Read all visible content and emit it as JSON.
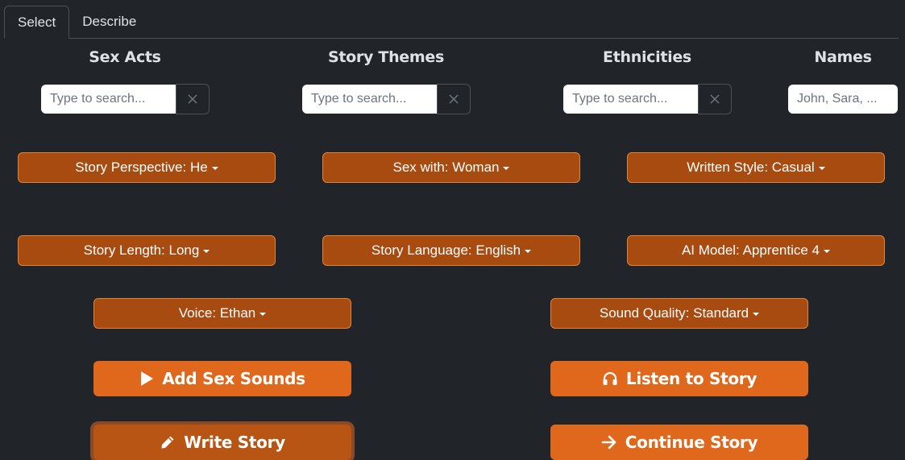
{
  "tabs": [
    "Select",
    "Describe"
  ],
  "columns": {
    "sex_acts": {
      "title": "Sex Acts",
      "placeholder": "Type to search..."
    },
    "story_themes": {
      "title": "Story Themes",
      "placeholder": "Type to search..."
    },
    "ethnicities": {
      "title": "Ethnicities",
      "placeholder": "Type to search..."
    },
    "names": {
      "title": "Names",
      "placeholder": "John, Sara, ..."
    }
  },
  "dropdowns": {
    "story_perspective": "Story Perspective: He",
    "sex_with": "Sex with: Woman",
    "written_style": "Written Style: Casual",
    "story_length": "Story Length: Long",
    "story_language": "Story Language: English",
    "ai_model": "AI Model: Apprentice 4",
    "voice": "Voice: Ethan",
    "sound_quality": "Sound Quality: Standard"
  },
  "actions": {
    "add_sex_sounds": "Add Sex Sounds",
    "listen_to_story": "Listen to Story",
    "write_story": "Write Story",
    "continue_story": "Continue Story"
  },
  "icons": {
    "add_sex_sounds": "play-icon",
    "listen_to_story": "headphones-icon",
    "write_story": "pencil-icon",
    "continue_story": "arrow-right-icon",
    "clear": "close-icon"
  },
  "colors": {
    "background": "#212529",
    "dropdown": "#a84b10",
    "action": "#e0681c",
    "action_focused": "#b85514"
  }
}
